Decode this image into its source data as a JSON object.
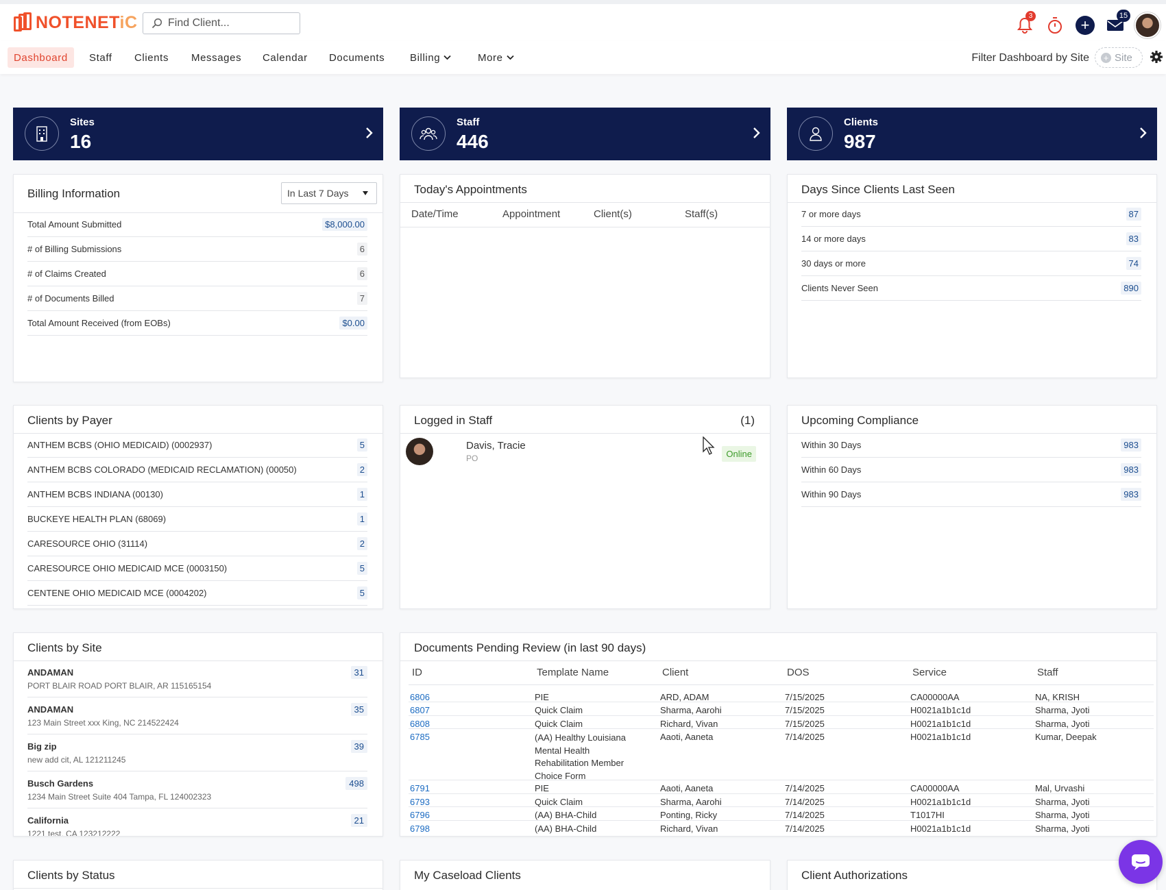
{
  "brand": {
    "logo_text_a": "NOTENET",
    "logo_text_b": "iC"
  },
  "search": {
    "placeholder": "Find Client..."
  },
  "header": {
    "notifications_count": "3",
    "messages_count": "15"
  },
  "nav": {
    "items": [
      "Dashboard",
      "Staff",
      "Clients",
      "Messages",
      "Calendar",
      "Documents",
      "Billing",
      "More"
    ],
    "filter_label": "Filter Dashboard by Site",
    "site_pill": "Site"
  },
  "stats": [
    {
      "label": "Sites",
      "value": "16"
    },
    {
      "label": "Staff",
      "value": "446"
    },
    {
      "label": "Clients",
      "value": "987"
    }
  ],
  "billing": {
    "title": "Billing Information",
    "range": "In Last 7 Days",
    "rows": [
      {
        "label": "Total Amount Submitted",
        "value": "$8,000.00"
      },
      {
        "label": "# of Billing Submissions",
        "value": "6"
      },
      {
        "label": "# of Claims Created",
        "value": "6"
      },
      {
        "label": "# of Documents Billed",
        "value": "7"
      },
      {
        "label": "Total Amount Received (from EOBs)",
        "value": "$0.00"
      }
    ]
  },
  "appointments": {
    "title": "Today's Appointments",
    "columns": [
      "Date/Time",
      "Appointment",
      "Client(s)",
      "Staff(s)"
    ]
  },
  "last_seen": {
    "title": "Days Since Clients Last Seen",
    "rows": [
      {
        "label": "7 or more days",
        "value": "87"
      },
      {
        "label": "14 or more days",
        "value": "83"
      },
      {
        "label": "30 days or more",
        "value": "74"
      },
      {
        "label": "Clients Never Seen",
        "value": "890"
      }
    ]
  },
  "payers": {
    "title": "Clients by Payer",
    "rows": [
      {
        "label": "ANTHEM BCBS (OHIO MEDICAID) (0002937)",
        "value": "5"
      },
      {
        "label": "ANTHEM BCBS COLORADO (MEDICAID RECLAMATION) (00050)",
        "value": "2"
      },
      {
        "label": "ANTHEM BCBS INDIANA (00130)",
        "value": "1"
      },
      {
        "label": "BUCKEYE HEALTH PLAN (68069)",
        "value": "1"
      },
      {
        "label": "CARESOURCE OHIO (31114)",
        "value": "2"
      },
      {
        "label": "CARESOURCE OHIO MEDICAID MCE (0003150)",
        "value": "5"
      },
      {
        "label": "CENTENE OHIO MEDICAID MCE (0004202)",
        "value": "5"
      }
    ]
  },
  "logged_in": {
    "title": "Logged in Staff",
    "count": "(1)",
    "staff": {
      "name": "Davis, Tracie",
      "role": "PO",
      "status": "Online"
    }
  },
  "compliance": {
    "title": "Upcoming Compliance",
    "rows": [
      {
        "label": "Within 30 Days",
        "value": "983"
      },
      {
        "label": "Within 60 Days",
        "value": "983"
      },
      {
        "label": "Within 90 Days",
        "value": "983"
      }
    ]
  },
  "sites": {
    "title": "Clients by Site",
    "rows": [
      {
        "name": "ANDAMAN",
        "address": "PORT BLAIR ROAD PORT BLAIR, AR 115165154",
        "count": "31"
      },
      {
        "name": "ANDAMAN",
        "address": "123 Main Street xxx King, NC 214522424",
        "count": "35"
      },
      {
        "name": "Big zip",
        "address": "new add cit, AL 121211245",
        "count": "39"
      },
      {
        "name": "Busch Gardens",
        "address": "1234 Main Street Suite 404 Tampa, FL 124002323",
        "count": "498"
      },
      {
        "name": "California",
        "address": "1221 test, CA 123212222",
        "count": "21"
      }
    ]
  },
  "documents": {
    "title": "Documents Pending Review (in last 90 days)",
    "columns": [
      "ID",
      "Template Name",
      "Client",
      "DOS",
      "Service",
      "Staff"
    ],
    "rows": [
      {
        "id": "6806",
        "template": "PIE",
        "client": "ARD, ADAM",
        "dos": "7/15/2025",
        "service": "CA00000AA",
        "staff": "NA, KRISH"
      },
      {
        "id": "6807",
        "template": "Quick Claim",
        "client": "Sharma, Aarohi",
        "dos": "7/15/2025",
        "service": "H0021a1b1c1d",
        "staff": "Sharma, Jyoti"
      },
      {
        "id": "6808",
        "template": "Quick Claim",
        "client": "Richard, Vivan",
        "dos": "7/15/2025",
        "service": "H0021a1b1c1d",
        "staff": "Sharma, Jyoti"
      },
      {
        "id": "6785",
        "template_lines": [
          "(AA) Healthy Louisiana",
          "Mental Health",
          "Rehabilitation Member",
          "Choice Form"
        ],
        "client": "Aaoti, Aaneta",
        "dos": "7/14/2025",
        "service": "H0021a1b1c1d",
        "staff": "Kumar, Deepak"
      },
      {
        "id": "6791",
        "template": "PIE",
        "client": "Aaoti, Aaneta",
        "dos": "7/14/2025",
        "service": "CA00000AA",
        "staff": "Mal, Urvashi"
      },
      {
        "id": "6793",
        "template": "Quick Claim",
        "client": "Sharma, Aarohi",
        "dos": "7/14/2025",
        "service": "H0021a1b1c1d",
        "staff": "Sharma, Jyoti"
      },
      {
        "id": "6796",
        "template": "(AA) BHA-Child",
        "client": "Ponting, Ricky",
        "dos": "7/14/2025",
        "service": "T1017HI",
        "staff": "Sharma, Jyoti"
      },
      {
        "id": "6798",
        "template": "(AA) BHA-Child",
        "client": "Richard, Vivan",
        "dos": "7/14/2025",
        "service": "H0021a1b1c1d",
        "staff": "Sharma, Jyoti"
      }
    ]
  },
  "bottom_panels": [
    "Clients by Status",
    "My Caseload Clients",
    "Client Authorizations"
  ],
  "colors": {
    "navy": "#0f1c4d",
    "accent": "#f0512b",
    "link": "#1b6bc2",
    "online": "#3d9b2a",
    "chat": "#7b35e6"
  }
}
